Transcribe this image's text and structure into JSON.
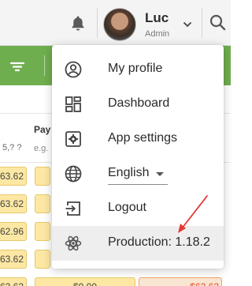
{
  "header": {
    "user_name": "Luc",
    "user_role": "Admin",
    "icons": [
      "bell-icon",
      "avatar",
      "chevron-down-icon",
      "search-icon"
    ]
  },
  "table": {
    "column_header": "Pay",
    "column_subheader": "e.g.",
    "left_header_fragment": "5,? ?",
    "left_values": [
      "63.62",
      "63.62",
      "62.96",
      "63.62",
      "63.62"
    ],
    "bottom_values": [
      "$0.00",
      "$63.62"
    ]
  },
  "menu": {
    "items": [
      {
        "label": "My profile",
        "icon": "account-circle-icon"
      },
      {
        "label": "Dashboard",
        "icon": "dashboard-icon"
      },
      {
        "label": "App settings",
        "icon": "settings-icon"
      },
      {
        "label": "English",
        "icon": "globe-icon",
        "type": "select"
      },
      {
        "label": "Logout",
        "icon": "logout-icon"
      },
      {
        "label": "Production: 1.18.2",
        "icon": "atom-icon",
        "active": true
      }
    ]
  },
  "annotation": {
    "color": "#e53935"
  }
}
